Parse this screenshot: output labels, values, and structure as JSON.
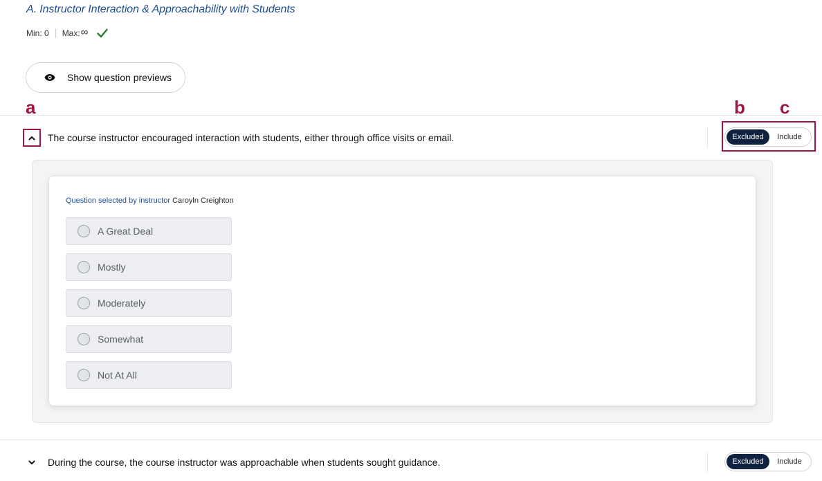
{
  "section": {
    "title": "A. Instructor Interaction & Approachability with Students",
    "min_label": "Min: 0",
    "max_label": "Max:",
    "max_value": "∞",
    "status_icon": "check-icon",
    "status_color": "#2e7d32"
  },
  "preview_button": {
    "label": "Show question previews",
    "icon": "eye-icon"
  },
  "annotations": {
    "a": "a",
    "b": "b",
    "c": "c",
    "color": "#a0173d"
  },
  "questions": [
    {
      "text": "The course instructor encouraged interaction with students, either through office visits or email.",
      "expanded": true,
      "toggle": {
        "excluded_label": "Excluded",
        "include_label": "Include",
        "active": "Excluded"
      },
      "selected_by_label": "Question selected by instructor",
      "instructor_name": "Caroyln Creighton",
      "answers": [
        "A Great Deal",
        "Mostly",
        "Moderately",
        "Somewhat",
        "Not At All"
      ]
    },
    {
      "text": "During the course, the course instructor was approachable when students sought guidance.",
      "expanded": false,
      "toggle": {
        "excluded_label": "Excluded",
        "include_label": "Include",
        "active": "Excluded"
      }
    }
  ],
  "colors": {
    "title": "#1f4f8f",
    "toggle_active": "#0f2340"
  }
}
